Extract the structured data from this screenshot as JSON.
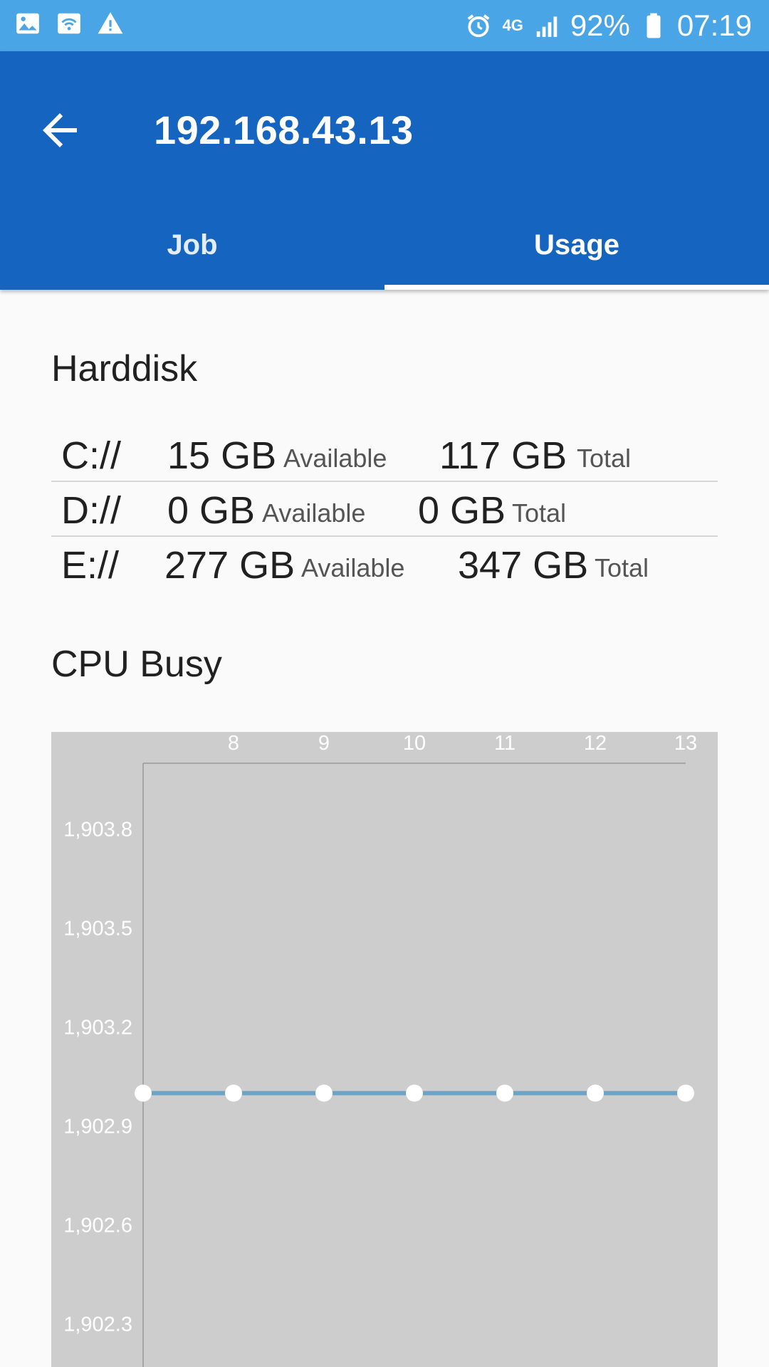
{
  "status_bar": {
    "battery": "92%",
    "time": "07:19",
    "network": "4G",
    "icons": [
      "image-icon",
      "wifi-icon",
      "warning-icon",
      "alarm-icon",
      "signal-icon",
      "battery-icon"
    ]
  },
  "app_bar": {
    "title": "192.168.43.13",
    "back_icon": "arrow-back-icon",
    "colors": {
      "primary": "#1565c0",
      "status": "#49a5e6"
    }
  },
  "tabs": [
    {
      "label": "Job",
      "selected": false
    },
    {
      "label": "Usage",
      "selected": true
    }
  ],
  "harddisk": {
    "title": "Harddisk",
    "available_label": "Available",
    "total_label": "Total",
    "drives": [
      {
        "name": "C://",
        "available": "15 GB",
        "total": "117 GB"
      },
      {
        "name": "D://",
        "available": "0 GB",
        "total": "0 GB"
      },
      {
        "name": "E://",
        "available": "277 GB",
        "total": "347 GB"
      }
    ]
  },
  "cpu": {
    "title": "CPU Busy"
  },
  "chart_data": {
    "type": "line",
    "title": "",
    "xlabel": "",
    "ylabel": "",
    "x_ticks": [
      8,
      9,
      10,
      11,
      12,
      13
    ],
    "y_ticks": [
      "1,903.8",
      "1,903.5",
      "1,903.2",
      "1,902.9",
      "1,902.6",
      "1,902.3"
    ],
    "y_tick_values": [
      1903.8,
      1903.5,
      1903.2,
      1902.9,
      1902.6,
      1902.3
    ],
    "x": [
      7,
      8,
      9,
      10,
      11,
      12,
      13
    ],
    "series": [
      {
        "values": [
          1903.0,
          1903.0,
          1903.0,
          1903.0,
          1903.0,
          1903.0,
          1903.0
        ]
      }
    ],
    "xlim": [
      7,
      13
    ],
    "ylim_top": 1904.0,
    "x_axis_position": "top",
    "grid": false,
    "colors": {
      "background": "#cdcdcd",
      "line": "#6fa3c6",
      "point": "#ffffff",
      "axis": "#999999"
    }
  }
}
